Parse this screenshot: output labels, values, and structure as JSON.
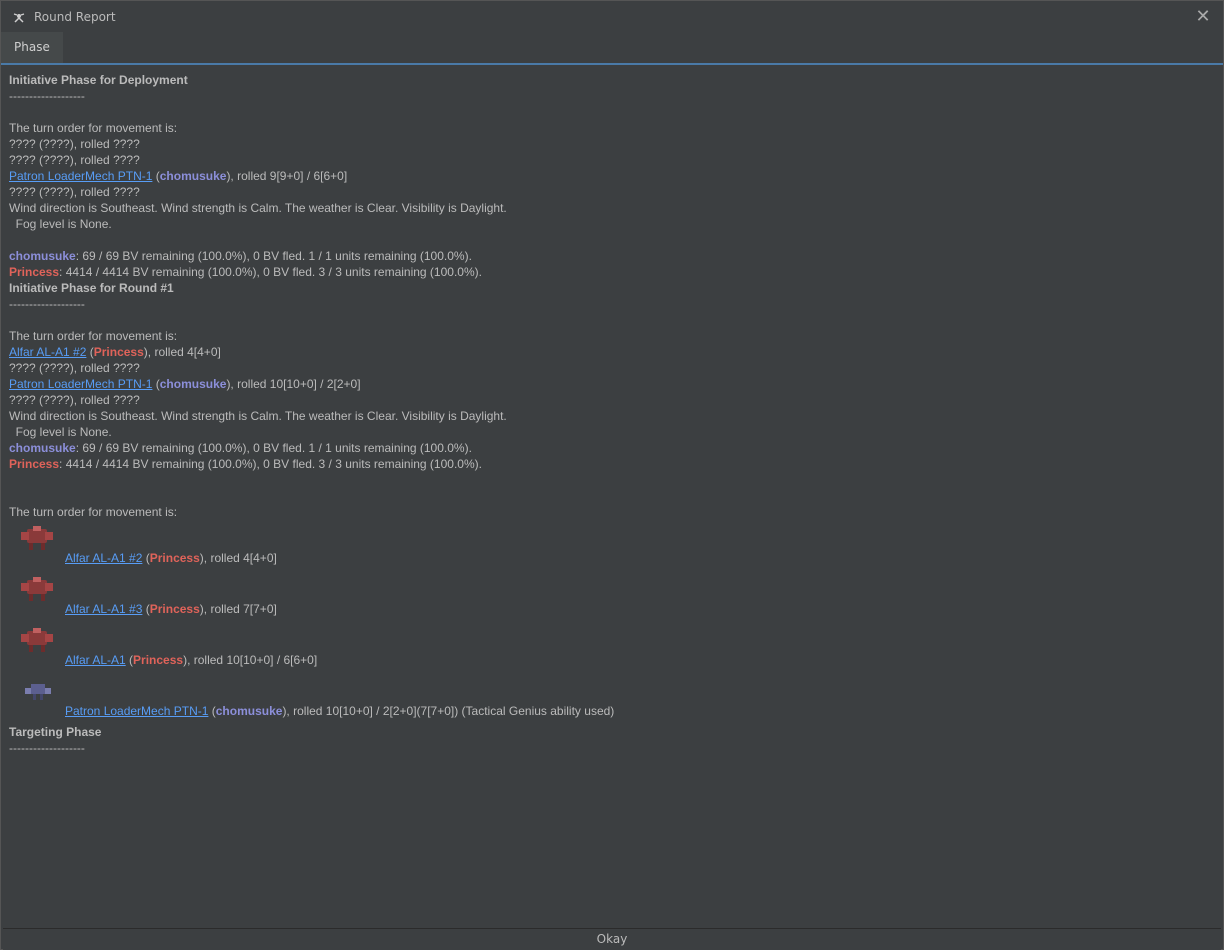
{
  "window": {
    "title": "Round Report",
    "close_label": "✕"
  },
  "tabs": [
    {
      "label": "Phase"
    }
  ],
  "report": {
    "dep_title": "Initiative Phase for Deployment",
    "divider": "-------------------",
    "turn_order_text": "The turn order for movement is:",
    "unknown_rolled": "???? (????), rolled ????",
    "weather": "Wind direction is Southeast.  Wind strength is Calm.  The weather is Clear.  Visibility is Daylight.",
    "fog": "  Fog level is None.",
    "player_blue": "chomusuke",
    "player_red": "Princess",
    "blue_bv": ": 69 / 69 BV remaining (100.0%), 0 BV fled. 1 / 1 units remaining (100.0%).",
    "red_bv": ": 4414 / 4414 BV remaining (100.0%), 0 BV fled. 3 / 3 units remaining (100.0%).",
    "round1_title": "Initiative Phase for Round #1",
    "targeting_title": "Targeting Phase",
    "open_paren": " (",
    "close_paren": ")",
    "dep_patron": {
      "unit": "Patron LoaderMech PTN-1",
      "roll": "), rolled 9[9+0] / 6[6+0]"
    },
    "r1_alfar2": {
      "unit": "Alfar AL-A1 #2",
      "roll": "), rolled 4[4+0]"
    },
    "r1_patron": {
      "unit": "Patron LoaderMech PTN-1",
      "roll": "), rolled 10[10+0] / 2[2+0]"
    },
    "turn_entries": [
      {
        "unit": "Alfar AL-A1 #2",
        "player": "Princess",
        "roll": "), rolled 4[4+0]"
      },
      {
        "unit": "Alfar AL-A1 #3",
        "player": "Princess",
        "roll": "), rolled 7[7+0]"
      },
      {
        "unit": "Alfar AL-A1",
        "player": "Princess",
        "roll": "), rolled 10[10+0] / 6[6+0]"
      },
      {
        "unit": "Patron LoaderMech PTN-1",
        "player": "chomusuke",
        "roll": "), rolled 10[10+0] / 2[2+0](7[7+0]) (Tactical Genius ability used)"
      }
    ]
  },
  "footer": {
    "okay_label": "Okay"
  },
  "colors": {
    "link": "#589df6",
    "player_blue": "#8c8fda",
    "player_red": "#e0635a",
    "background": "#3c3f41"
  }
}
